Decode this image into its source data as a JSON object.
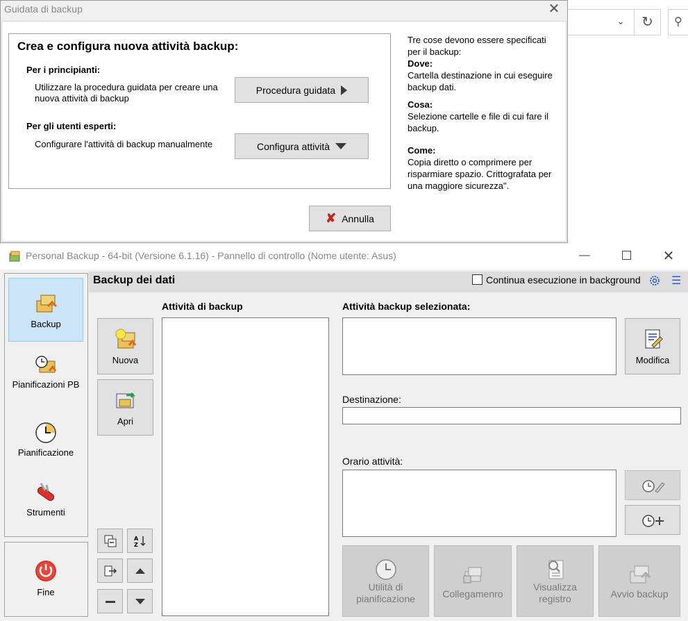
{
  "browser_bg": {
    "chevron": "⌄",
    "refresh": "↻",
    "search": "⚲"
  },
  "wizard": {
    "title": "Guidata di backup",
    "heading": "Crea e configura nuova attività backup:",
    "beginners_title": "Per i principianti:",
    "beginners_text": "Utilizzare la procedura guidata per creare una nuova attività di backup",
    "wizard_button": "Procedura guidata",
    "experts_title": "Per gli utenti esperti:",
    "experts_text": "Configurare l'attività di backup manualmente",
    "configure_button": "Configura attività",
    "cancel_button": "Annulla",
    "side_intro": "Tre cose devono essere specificati per il backup:",
    "side_where_title": "Dove:",
    "side_where_text": "Cartella destinazione in cui eseguire backup dati.",
    "side_what_title": "Cosa:",
    "side_what_text": "Selezione cartelle e file di cui fare il backup.",
    "side_how_title": "Come:",
    "side_how_text": "Copia diretto o comprimere per risparmiare spazio. Crittografata per una maggiore sicurezza\"."
  },
  "main": {
    "title": "Personal Backup - 64-bit (Versione 6.1.16) - Pannello di controllo (Nome utente: Asus)",
    "nav": {
      "backup": "Backup",
      "schedules_pb": "Pianificazioni PB",
      "scheduling": "Pianificazione",
      "tools": "Strumenti",
      "exit": "Fine"
    },
    "header_title": "Backup dei dati",
    "background_checkbox_label": "Continua esecuzione in background",
    "background_checked": false,
    "new_button": "Nuova",
    "open_button": "Apri",
    "task_list_title": "Attività di backup",
    "selected_title": "Attività backup selezionata:",
    "modify_button": "Modifica",
    "destination_label": "Destinazione:",
    "destination_value": "",
    "schedule_label": "Orario attività:",
    "bottom_buttons": {
      "schedule_utility_1": "Utilità di",
      "schedule_utility_2": "pianificazione",
      "link": "Collegamenro",
      "view_log_1": "Visualizza",
      "view_log_2": "registro",
      "start_backup": "Avvio backup"
    }
  },
  "colors": {
    "accent_blue": "#cce4f7",
    "exit_red": "#d8322b",
    "cancel_red": "#c0281c"
  }
}
